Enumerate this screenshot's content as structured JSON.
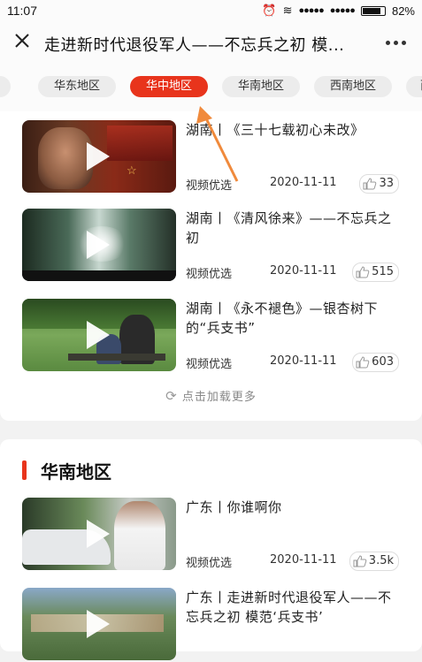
{
  "status": {
    "time": "11:07",
    "battery": "82%",
    "battery_level": 0.82
  },
  "titlebar": {
    "title": "走进新时代退役军人——不忘兵之初 模..."
  },
  "tabs": [
    "区",
    "华东地区",
    "华中地区",
    "华南地区",
    "西南地区",
    "西"
  ],
  "active_tab_index": 2,
  "section1": {
    "items": [
      {
        "title": "湖南丨《三十七载初心未改》",
        "source": "视频优选",
        "date": "2020-11-11",
        "likes": "33"
      },
      {
        "title": "湖南丨《清风徐来》——不忘兵之初",
        "source": "视频优选",
        "date": "2020-11-11",
        "likes": "515"
      },
      {
        "title": "湖南丨《永不褪色》—银杏树下的“兵支书”",
        "source": "视频优选",
        "date": "2020-11-11",
        "likes": "603"
      }
    ],
    "load_more": "点击加载更多"
  },
  "section2": {
    "heading": "华南地区",
    "items": [
      {
        "title": "广东丨你谁啊你",
        "source": "视频优选",
        "date": "2020-11-11",
        "likes": "3.5k"
      },
      {
        "title": "广东丨走进新时代退役军人——不忘兵之初 模范‘兵支书’"
      }
    ]
  },
  "colors": {
    "accent": "#e8341c",
    "arrow": "#f08a3c"
  }
}
